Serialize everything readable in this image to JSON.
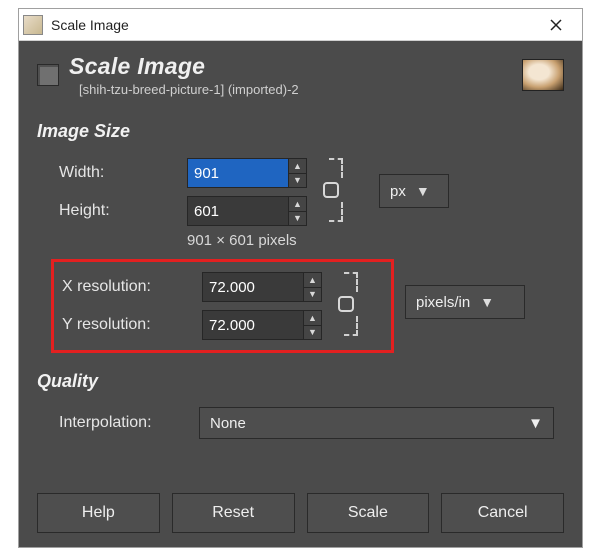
{
  "window": {
    "title": "Scale Image"
  },
  "header": {
    "title": "Scale Image",
    "subtitle": "[shih-tzu-breed-picture-1] (imported)-2"
  },
  "image_size": {
    "heading": "Image Size",
    "width_label": "Width:",
    "height_label": "Height:",
    "width": "901",
    "height": "601",
    "pixel_text": "901 × 601 pixels",
    "unit": "px"
  },
  "resolution": {
    "x_label": "X resolution:",
    "y_label": "Y resolution:",
    "x": "72.000",
    "y": "72.000",
    "unit": "pixels/in"
  },
  "quality": {
    "heading": "Quality",
    "interp_label": "Interpolation:",
    "interp_value": "None"
  },
  "buttons": {
    "help": "Help",
    "reset": "Reset",
    "scale": "Scale",
    "cancel": "Cancel"
  }
}
